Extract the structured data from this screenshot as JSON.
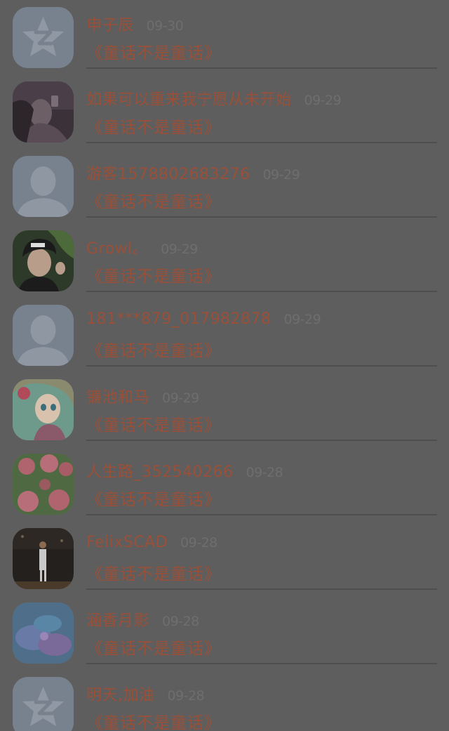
{
  "comments": [
    {
      "name": "申子辰",
      "date": "09-30",
      "text": "《童话不是童话》",
      "avatar_icon": "qq-default-avatar-icon"
    },
    {
      "name": "如果可以重来我宁愿从未开始",
      "date": "09-29",
      "text": "《童话不是童话》",
      "avatar_icon": "user-photo-avatar"
    },
    {
      "name": "游客1578802683276",
      "date": "09-29",
      "text": "《童话不是童话》",
      "avatar_icon": "guest-person-avatar-icon"
    },
    {
      "name": "Growl。",
      "date": "09-29",
      "text": "《童话不是童话》",
      "avatar_icon": "user-photo-avatar"
    },
    {
      "name": "181***879_017982878",
      "date": "09-29",
      "text": "《童话不是童话》",
      "avatar_icon": "guest-person-avatar-icon"
    },
    {
      "name": "镰池和马",
      "date": "09-29",
      "text": "《童话不是童话》",
      "avatar_icon": "anime-girl-avatar"
    },
    {
      "name": "人生路_352540266",
      "date": "09-28",
      "text": "《童话不是童话》",
      "avatar_icon": "roses-avatar"
    },
    {
      "name": "FelixSCAD",
      "date": "09-28",
      "text": "《童话不是童话》",
      "avatar_icon": "basketball-player-avatar"
    },
    {
      "name": "涵香月影",
      "date": "09-28",
      "text": "《童话不是童话》",
      "avatar_icon": "blue-flower-avatar"
    },
    {
      "name": "明天,加油",
      "date": "09-28",
      "text": "《童话不是童话》",
      "avatar_icon": "qq-default-avatar-icon"
    }
  ]
}
